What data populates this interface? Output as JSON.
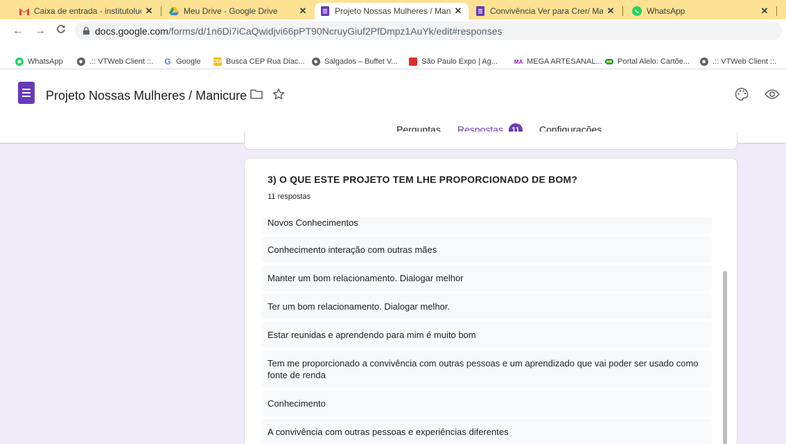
{
  "browser": {
    "tabs": [
      {
        "title": "Caixa de entrada - institutolucas",
        "icon": "gmail-icon"
      },
      {
        "title": "Meu Drive - Google Drive",
        "icon": "google-drive-icon"
      },
      {
        "title": "Projeto Nossas Mulheres / Manic",
        "icon": "google-forms-icon",
        "active": true
      },
      {
        "title": "Convivência Ver para Crer/ Maio",
        "icon": "google-forms-icon"
      },
      {
        "title": "WhatsApp",
        "icon": "whatsapp-icon"
      }
    ],
    "url_domain": "docs.google.com",
    "url_path": "/forms/d/1n6Di7iCaQwidjvi66pPT90NcruyGiuf2PfDmpz1AuYk/edit#responses",
    "bookmarks": [
      {
        "label": "WhatsApp",
        "icon": "whatsapp-icon"
      },
      {
        "label": ".:: VTWeb Client ::.",
        "icon": "globe-icon"
      },
      {
        "label": "Google",
        "icon": "google-icon"
      },
      {
        "label": "Busca CEP Rua Diac...",
        "icon": "cep-icon"
      },
      {
        "label": "Salgados – Buffet V...",
        "icon": "globe-icon"
      },
      {
        "label": "São Paulo Expo | Ag...",
        "icon": "expo-icon"
      },
      {
        "label": "MEGA ARTESANAL...",
        "icon": "mega-artesanal-icon"
      },
      {
        "label": "Portal Alelo: Cartõe...",
        "icon": "alelo-icon"
      },
      {
        "label": ".:: VTWeb Client ::.",
        "icon": "globe-icon"
      }
    ]
  },
  "form": {
    "title": "Projeto Nossas Mulheres / Manicure",
    "tabs": {
      "questions": "Perguntas",
      "responses": "Respostas",
      "responses_count": "11",
      "settings": "Configurações"
    }
  },
  "question": {
    "title": "3) O QUE ESTE PROJETO TEM LHE PROPORCIONADO DE BOM?",
    "count": "11 respostas",
    "answers": [
      "Novos Conhecimentos",
      "Conhecimento interação com outras mães",
      "Manter um bom relacionamento. Dialogar melhor",
      "Ter um bom relacionamento. Dialogar melhor.",
      "Estar reunidas e aprendendo para mim é muito bom",
      "Tem me proporcionado a convivência com outras pessoas e um aprendizado que vai poder ser usado como fonte de renda",
      "Conhecimento",
      "A convivência com outras pessoas e experiências diferentes"
    ]
  },
  "colors": {
    "accent": "#673ab7",
    "page_background": "#f0ebf8",
    "tab_strip": "#fde293"
  }
}
